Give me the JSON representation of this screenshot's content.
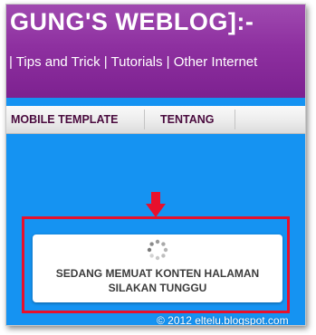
{
  "header": {
    "title": "GUNG'S WEBLOG]:-",
    "tagline": "| Tips and Trick | Tutorials | Other Internet"
  },
  "nav": {
    "items": [
      {
        "label": "MOBILE TEMPLATE"
      },
      {
        "label": "TENTANG"
      }
    ]
  },
  "loading": {
    "line1": "SEDANG MEMUAT KONTEN HALAMAN",
    "line2": "SILAKAN TUNGGU",
    "spinner_icon": "loading-spinner-icon"
  },
  "annotation": {
    "arrow_icon": "arrow-down-icon",
    "highlight_color": "#e8102c"
  },
  "watermark": {
    "text": "© 2012 eltelu.blogspot.com"
  },
  "colors": {
    "header_purple": "#8e30a0",
    "content_blue": "#1593f2",
    "nav_text": "#4a0b3e"
  }
}
